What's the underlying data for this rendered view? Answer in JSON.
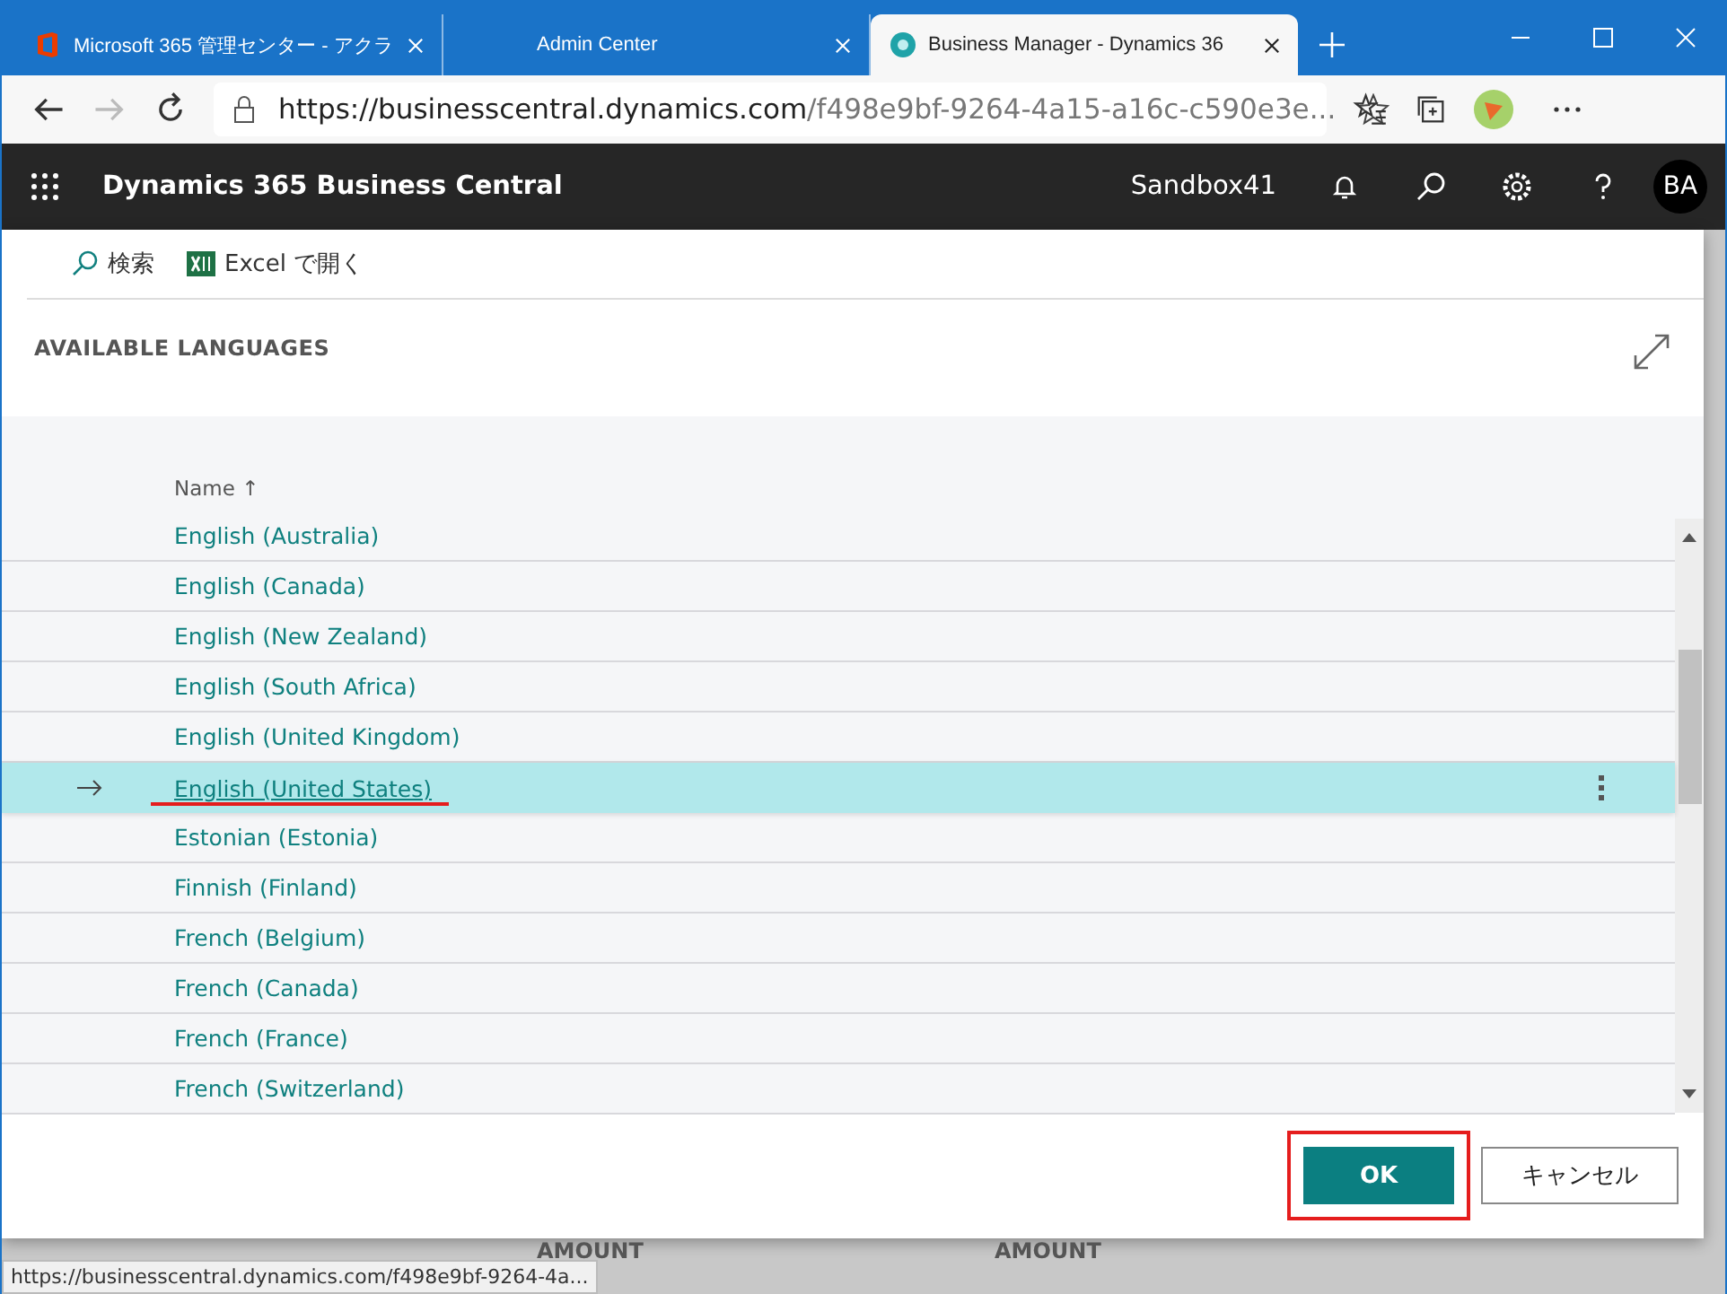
{
  "browser": {
    "tabs": [
      {
        "title": "Microsoft 365 管理センター - アクラ",
        "selected": false
      },
      {
        "title": "Admin Center",
        "selected": false
      },
      {
        "title": "Business Manager - Dynamics 36",
        "selected": true
      }
    ],
    "url_host": "https://businesscentral.dynamics.com",
    "url_path": "/f498e9bf-9264-4a15-a16c-c590e3e..."
  },
  "app": {
    "title": "Dynamics 365 Business Central",
    "environment": "Sandbox41",
    "avatar": "BA"
  },
  "actions": [
    {
      "label": "検索"
    },
    {
      "label": "Excel で開く"
    }
  ],
  "dialog": {
    "title": "AVAILABLE LANGUAGES",
    "column": "Name",
    "sort_mark": "↑",
    "rows": [
      {
        "name": "English (Australia)",
        "selected": false,
        "annotated": false
      },
      {
        "name": "English (Canada)",
        "selected": false,
        "annotated": false
      },
      {
        "name": "English (New Zealand)",
        "selected": false,
        "annotated": false
      },
      {
        "name": "English (South Africa)",
        "selected": false,
        "annotated": false
      },
      {
        "name": "English (United Kingdom)",
        "selected": false,
        "annotated": false
      },
      {
        "name": "English (United States)",
        "selected": true,
        "annotated": true
      },
      {
        "name": "Estonian (Estonia)",
        "selected": false,
        "annotated": false
      },
      {
        "name": "Finnish (Finland)",
        "selected": false,
        "annotated": false
      },
      {
        "name": "French (Belgium)",
        "selected": false,
        "annotated": false
      },
      {
        "name": "French (Canada)",
        "selected": false,
        "annotated": false
      },
      {
        "name": "French (France)",
        "selected": false,
        "annotated": false
      },
      {
        "name": "French (Switzerland)",
        "selected": false,
        "annotated": false
      }
    ],
    "ok": {
      "label": "OK",
      "annotated": true
    },
    "cancel": "キャンセル"
  },
  "background": {
    "labels": [
      "AMOUNT",
      "AMOUNT"
    ]
  },
  "status_url": "https://businesscentral.dynamics.com/f498e9bf-9264-4a..."
}
